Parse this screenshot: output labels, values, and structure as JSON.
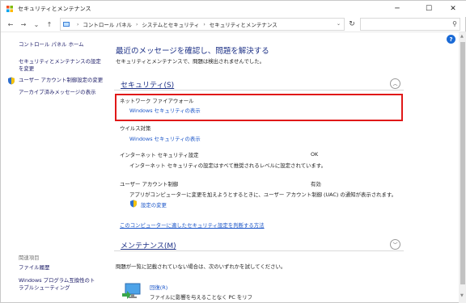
{
  "window": {
    "title": "セキュリティとメンテナンス",
    "controls": {
      "minimize": "─",
      "maximize": "☐",
      "close": "✕"
    }
  },
  "nav": {
    "back": "←",
    "forward": "→",
    "recent": "⌄",
    "up": "↑",
    "breadcrumb": [
      "コントロール パネル",
      "システムとセキュリティ",
      "セキュリティとメンテナンス"
    ],
    "refresh": "↻"
  },
  "sidebar": {
    "items": [
      {
        "label": "コントロール パネル ホーム"
      },
      {
        "label": "セキュリティとメンテナンスの設定を変更"
      },
      {
        "label": "ユーザー アカウント制御設定の変更",
        "icon": "shield-icon"
      },
      {
        "label": "アーカイブ済みメッセージの表示"
      }
    ],
    "related_header": "関連項目",
    "related": [
      {
        "label": "ファイル履歴"
      },
      {
        "label": "Windows プログラム互換性のトラブルシューティング"
      }
    ]
  },
  "help": "?",
  "main": {
    "heading": "最近のメッセージを確認し、問題を解決する",
    "subheading": "セキュリティとメンテナンスで、問題は検出されませんでした。",
    "security": {
      "label": "セキュリティ(S)",
      "toggle": "︿",
      "items": [
        {
          "title": "ネットワーク ファイアウォール",
          "link": "Windows セキュリティの表示"
        },
        {
          "title": "ウイルス対策",
          "link": "Windows セキュリティの表示"
        },
        {
          "title": "インターネット セキュリティ設定",
          "status": "OK",
          "desc": "インターネット セキュリティの設定はすべて推奨されるレベルに設定されています。"
        },
        {
          "title": "ユーザー アカウント制御",
          "status": "有効",
          "desc": "アプリがコンピューターに変更を加えようとするときに、ユーザー アカウント制御 (UAC) の通知が表示されます。",
          "link": "設定の変更"
        }
      ],
      "bottom_link": "このコンピューターに適したセキュリティ設定を判断する方法"
    },
    "maintenance": {
      "label": "メンテナンス(M)",
      "toggle": "﹀",
      "desc": "問題が一覧に記載されていない場合は、次のいずれかを試してください。",
      "troubleshoot_link": "回復(R)",
      "troubleshoot_desc": "ファイルに影響を与えることなく PC をリフ"
    }
  },
  "colors": {
    "accent_heading": "#1e3287",
    "link": "#1a55c8",
    "highlight_border": "#e01818",
    "help_badge": "#1a6ad6"
  }
}
